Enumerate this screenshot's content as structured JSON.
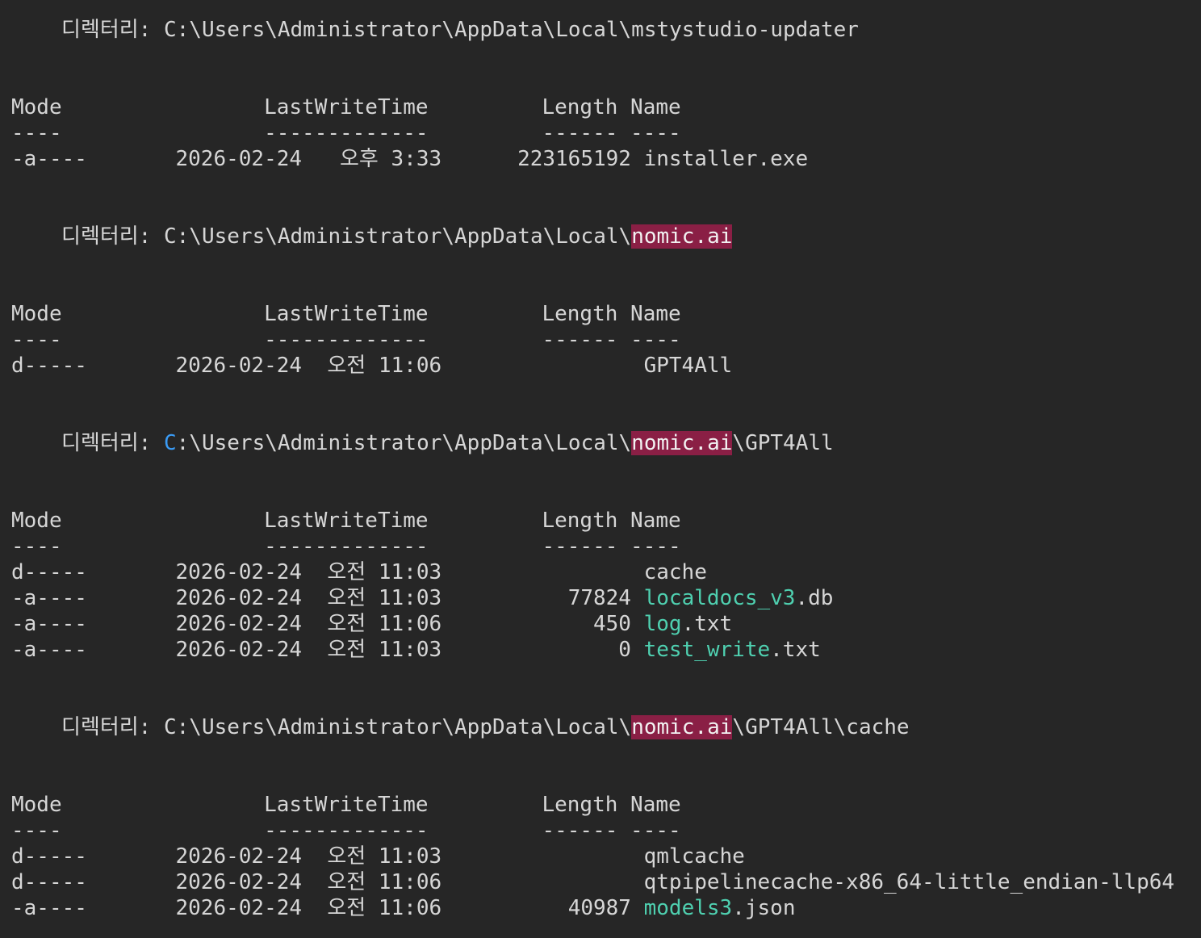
{
  "colors": {
    "background": "#262626",
    "text": "#d6d6d6",
    "highlight_bg": "#8a1f45",
    "file_stem": "#4fd0b0",
    "cursor_c": "#3a9bf5"
  },
  "labels": {
    "dir_label": "디렉터리:",
    "hdr_mode": "Mode",
    "hdr_lastwritetime": "LastWriteTime",
    "hdr_length": "Length",
    "hdr_name": "Name",
    "sep_mode": "----",
    "sep_lastwritetime": "-------------",
    "sep_length": "------",
    "sep_name": "----"
  },
  "sections": [
    {
      "path_pre": "C:\\Users\\Administrator\\AppData\\Local\\mstystudio-updater",
      "path_hl": "",
      "path_post": "",
      "rows": [
        {
          "mode": "-a----",
          "date": "2026-02-24",
          "ampm": "오후",
          "time": " 3:33",
          "length": "223165192",
          "name_stem": "",
          "name_rest": "installer.exe"
        }
      ]
    },
    {
      "path_pre": "C:\\Users\\Administrator\\AppData\\Local\\",
      "path_hl": "nomic.ai",
      "path_post": "",
      "rows": [
        {
          "mode": "d-----",
          "date": "2026-02-24",
          "ampm": "오전",
          "time": "11:06",
          "length": "",
          "name_stem": "",
          "name_rest": "GPT4All"
        }
      ]
    },
    {
      "path_c": "C",
      "path_pre": ":\\Users\\Administrator\\AppData\\Local\\",
      "path_hl": "nomic.ai",
      "path_post": "\\GPT4All",
      "rows": [
        {
          "mode": "d-----",
          "date": "2026-02-24",
          "ampm": "오전",
          "time": "11:03",
          "length": "",
          "name_stem": "",
          "name_rest": "cache"
        },
        {
          "mode": "-a----",
          "date": "2026-02-24",
          "ampm": "오전",
          "time": "11:03",
          "length": "77824",
          "name_stem": "localdocs_v3",
          "name_rest": ".db"
        },
        {
          "mode": "-a----",
          "date": "2026-02-24",
          "ampm": "오전",
          "time": "11:06",
          "length": "450",
          "name_stem": "log",
          "name_rest": ".txt"
        },
        {
          "mode": "-a----",
          "date": "2026-02-24",
          "ampm": "오전",
          "time": "11:03",
          "length": "0",
          "name_stem": "test_write",
          "name_rest": ".txt"
        }
      ]
    },
    {
      "path_pre": "C:\\Users\\Administrator\\AppData\\Local\\",
      "path_hl": "nomic.ai",
      "path_post": "\\GPT4All\\cache",
      "rows": [
        {
          "mode": "d-----",
          "date": "2026-02-24",
          "ampm": "오전",
          "time": "11:03",
          "length": "",
          "name_stem": "",
          "name_rest": "qmlcache"
        },
        {
          "mode": "d-----",
          "date": "2026-02-24",
          "ampm": "오전",
          "time": "11:06",
          "length": "",
          "name_stem": "",
          "name_rest": "qtpipelinecache-x86_64-little_endian-llp64"
        },
        {
          "mode": "-a----",
          "date": "2026-02-24",
          "ampm": "오전",
          "time": "11:06",
          "length": "40987",
          "name_stem": "models3",
          "name_rest": ".json"
        }
      ]
    }
  ]
}
